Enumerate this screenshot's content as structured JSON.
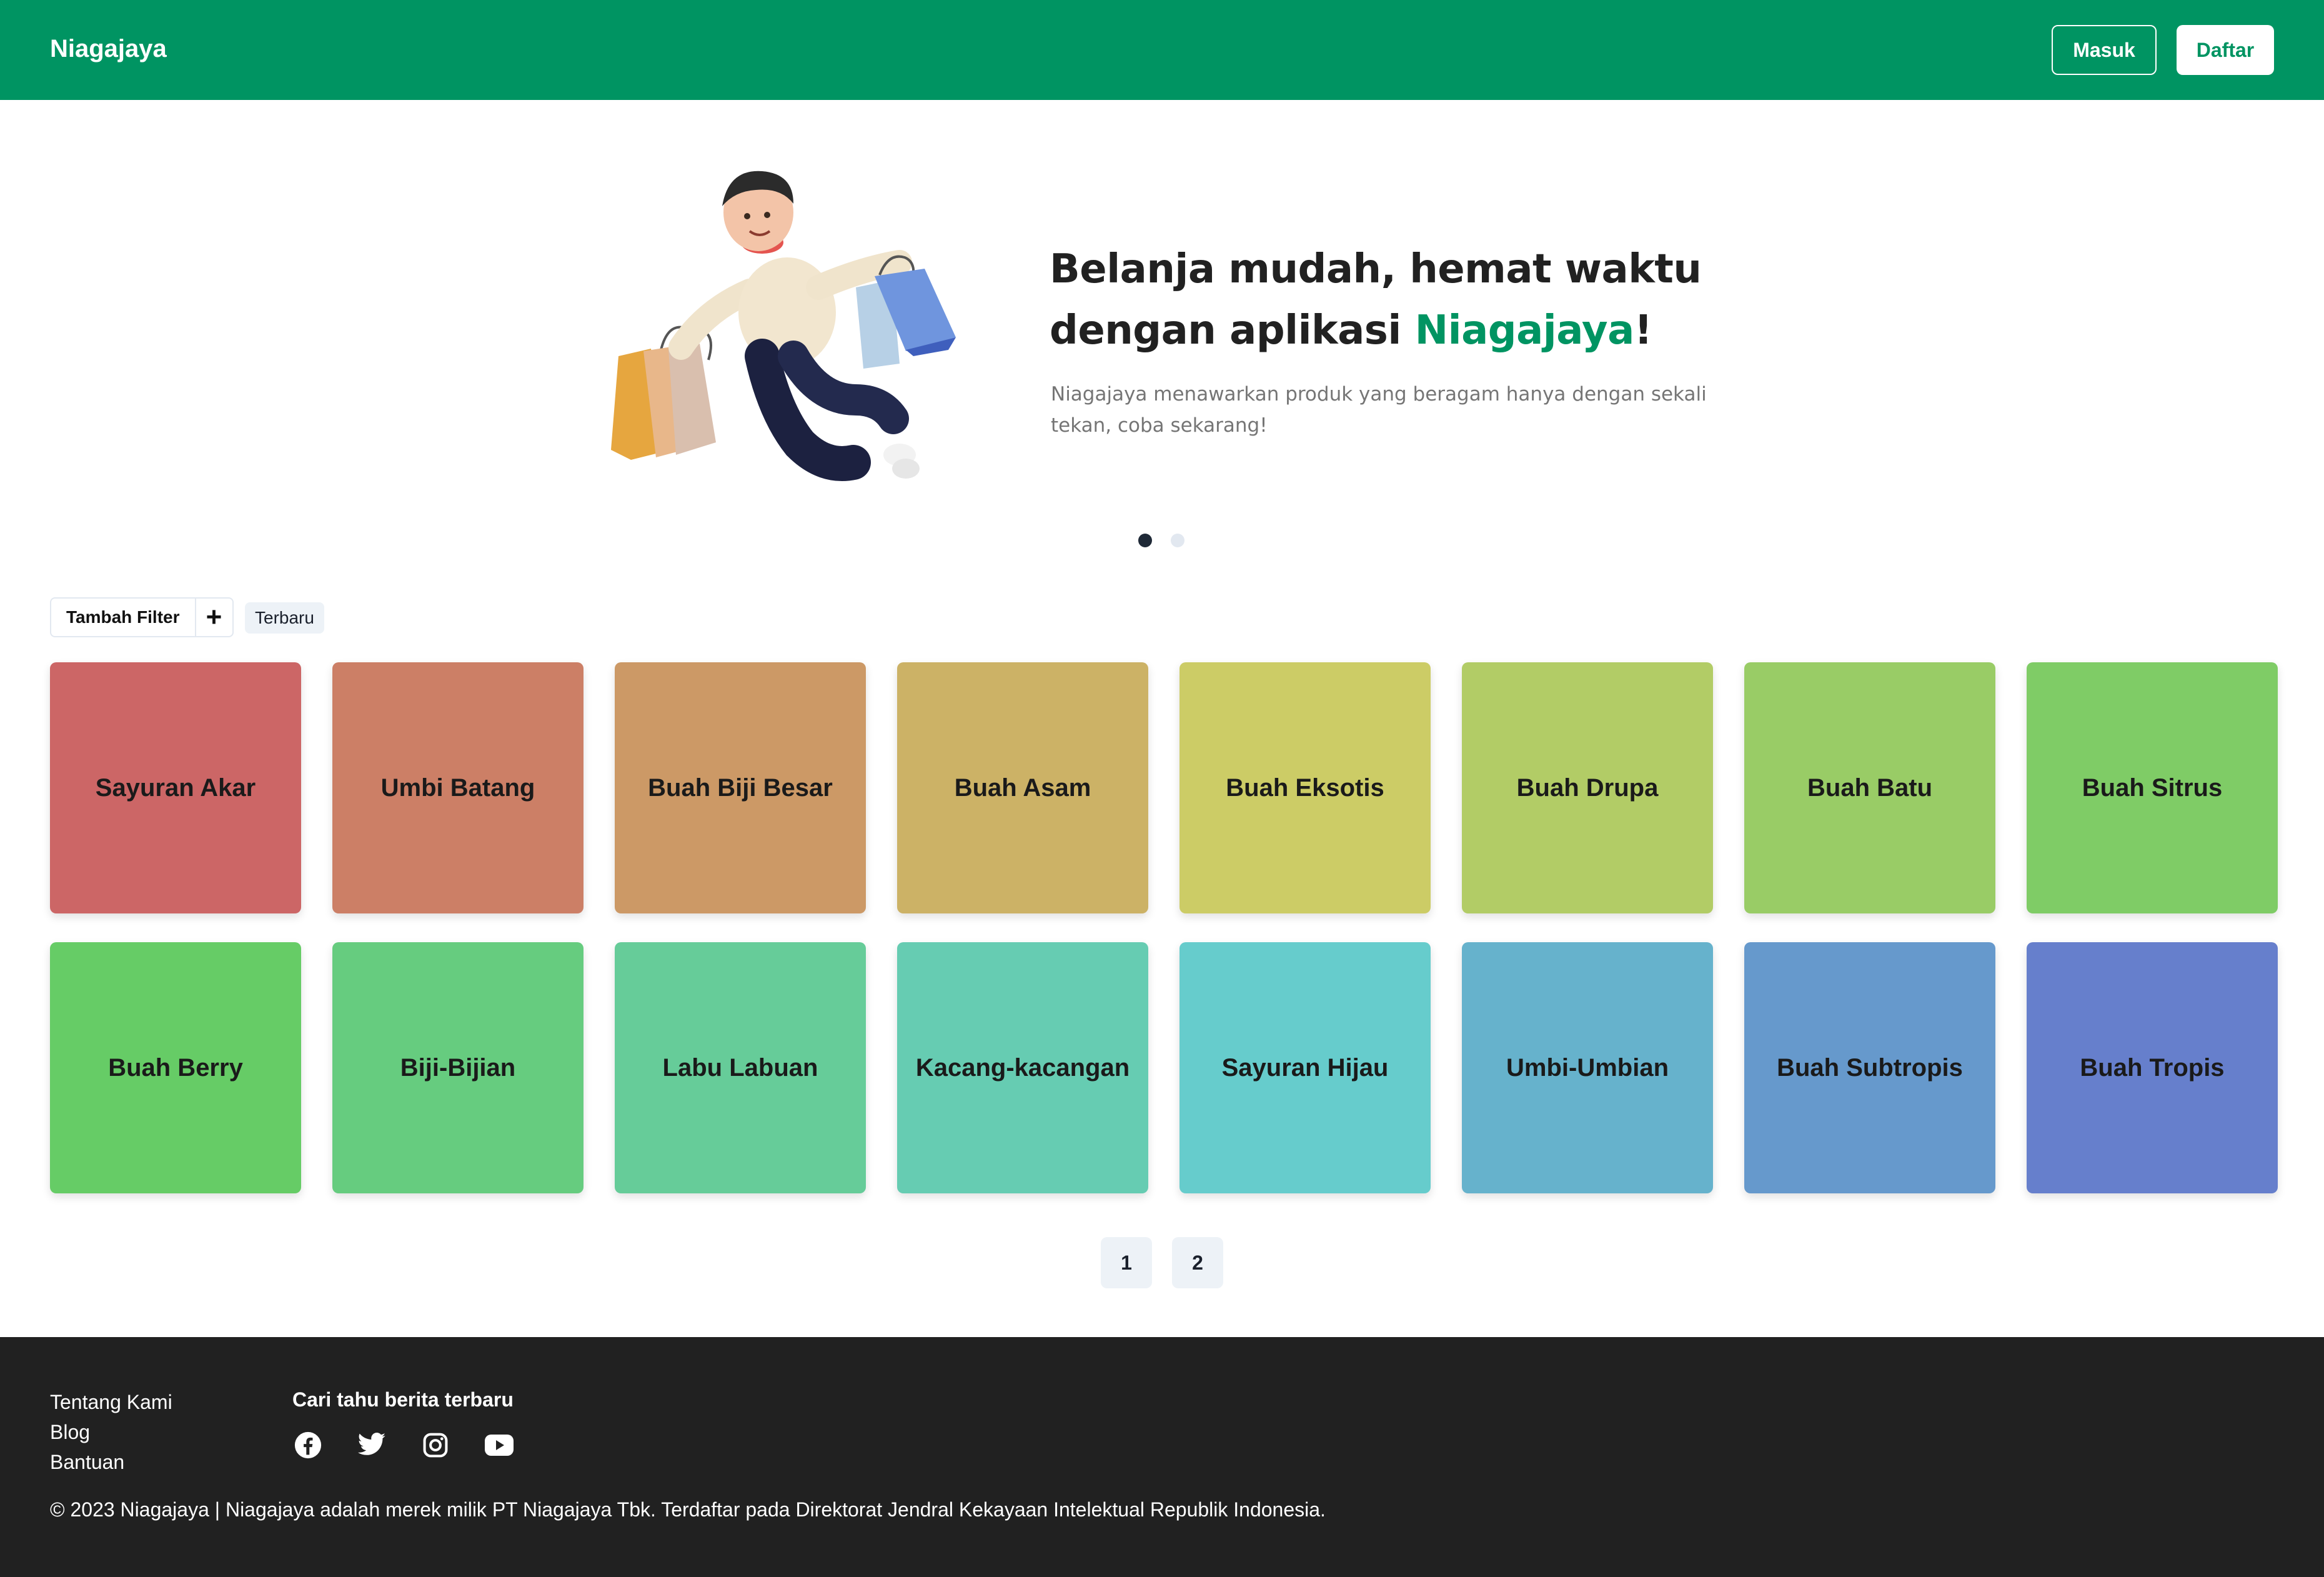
{
  "header": {
    "brand": "Niagajaya",
    "login_label": "Masuk",
    "register_label": "Daftar",
    "brand_color": "#009462"
  },
  "hero": {
    "title_line1": "Belanja mudah, hemat waktu",
    "title_line2_prefix": "dengan aplikasi ",
    "title_brand": "Niagajaya",
    "title_suffix": "!",
    "description": "Niagajaya menawarkan produk yang beragam hanya dengan sekali tekan, coba sekarang!",
    "illustration_icon": "shopper-with-bags-illustration",
    "carousel_slide_count": 2,
    "carousel_active_slide": 1
  },
  "filter": {
    "add_filter_label": "Tambah Filter",
    "add_icon": "plus-icon",
    "sort_tag": "Terbaru"
  },
  "categories": [
    {
      "label": "Sayuran Akar",
      "color": "#cc6666"
    },
    {
      "label": "Umbi Batang",
      "color": "#cc7f66"
    },
    {
      "label": "Buah Biji Besar",
      "color": "#cc9966"
    },
    {
      "label": "Buah Asam",
      "color": "#ccb266"
    },
    {
      "label": "Buah Eksotis",
      "color": "#cccc66"
    },
    {
      "label": "Buah Drupa",
      "color": "#b2cc66"
    },
    {
      "label": "Buah Batu",
      "color": "#99cc66"
    },
    {
      "label": "Buah Sitrus",
      "color": "#7fcc66"
    },
    {
      "label": "Buah Berry",
      "color": "#66cc66"
    },
    {
      "label": "Biji-Bijian",
      "color": "#66cc7f"
    },
    {
      "label": "Labu Labuan",
      "color": "#66cc99"
    },
    {
      "label": "Kacang-kacangan",
      "color": "#66ccb2"
    },
    {
      "label": "Sayuran Hijau",
      "color": "#66cccc"
    },
    {
      "label": "Umbi-Umbian",
      "color": "#66b2cc"
    },
    {
      "label": "Buah Subtropis",
      "color": "#6699cc"
    },
    {
      "label": "Buah Tropis",
      "color": "#667fcc"
    }
  ],
  "pagination": {
    "pages": [
      "1",
      "2"
    ]
  },
  "footer": {
    "links": [
      "Tentang Kami",
      "Blog",
      "Bantuan"
    ],
    "news_title": "Cari tahu berita terbaru",
    "social_icons": [
      "facebook-icon",
      "twitter-icon",
      "instagram-icon",
      "youtube-icon"
    ],
    "copyright": "© 2023 Niagajaya | Niagajaya adalah merek milik PT Niagajaya Tbk. Terdaftar pada Direktorat Jendral Kekayaan Intelektual Republik Indonesia."
  }
}
